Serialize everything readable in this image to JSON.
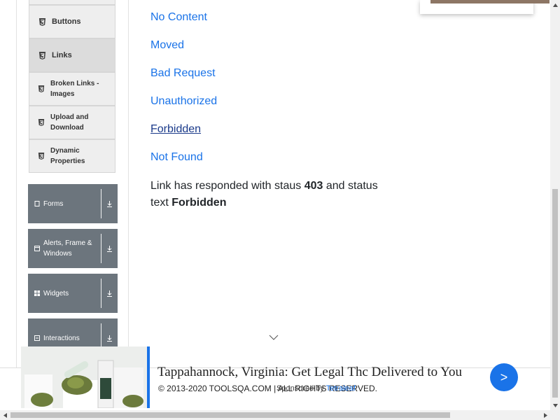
{
  "sidebar": {
    "elements_items": [
      {
        "label": "Buttons",
        "icon": "html5-icon"
      },
      {
        "label": "Links",
        "icon": "html5-icon",
        "active": true
      },
      {
        "label": "Broken Links - Images",
        "icon": "html5-icon"
      },
      {
        "label": "Upload and Download",
        "icon": "html5-icon"
      },
      {
        "label": "Dynamic Properties",
        "icon": "html5-icon"
      }
    ],
    "groups": [
      {
        "label": "Forms",
        "icon": "document-icon"
      },
      {
        "label": "Alerts, Frame & Windows",
        "icon": "window-icon"
      },
      {
        "label": "Widgets",
        "icon": "grid-icon"
      },
      {
        "label": "Interactions",
        "icon": "interaction-icon"
      }
    ]
  },
  "main": {
    "links": [
      "No Content",
      "Moved",
      "Bad Request",
      "Unauthorized",
      "Forbidden",
      "Not Found"
    ],
    "response": {
      "prefix": "Link has responded with staus",
      "code": "403",
      "middle": "and status text",
      "status_text": "Forbidden"
    }
  },
  "footer": {
    "copyright": "© 2013-2020 TOOLSQA.COM | ALL RIGHTS RESERVED."
  },
  "ad": {
    "title": "Tappahannock, Virginia: Get Legal Thc Delivered to You",
    "sponsored_by": "Sponsored by",
    "sponsor": "Tetraleaf",
    "button": ">"
  },
  "colors": {
    "link": "#1a73e8",
    "group_bg": "#6c757d",
    "ad_accent": "#1a73e8"
  }
}
